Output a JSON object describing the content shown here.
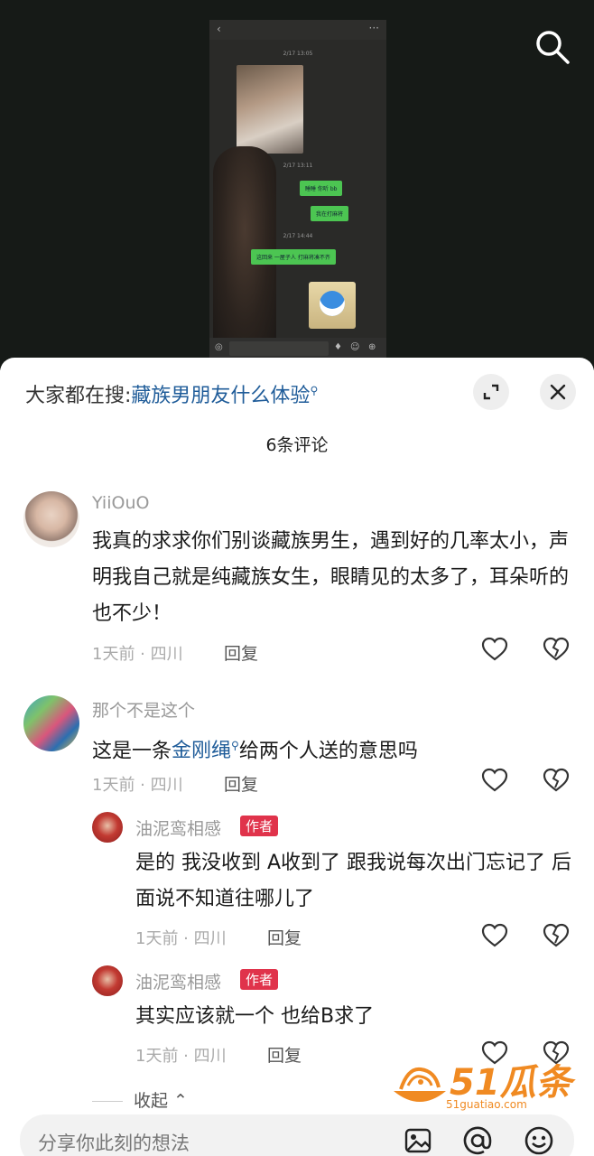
{
  "video": {
    "search_icon": "search-icon",
    "screenshot": {
      "time1": "2/17 13:05",
      "time2": "2/17 13:11",
      "time3": "2/17 14:44",
      "bubble1": "睡睡  你听 bb",
      "bubble2": "我在打麻将",
      "bubble3": "这回来 一屋子人 打麻将凑不齐"
    }
  },
  "sheet": {
    "suggest_prefix": "大家都在搜:",
    "suggest_query": "藏族男朋友什么体验",
    "comment_count": "6条评论",
    "comments": [
      {
        "user": "YiiOuO",
        "text": "我真的求求你们别谈藏族男生，遇到好的几率太小，声明我自己就是纯藏族女生，眼睛见的太多了，耳朵听的也不少！",
        "meta": "1天前 · 四川",
        "reply": "回复"
      },
      {
        "user": "那个不是这个",
        "text_before": "这是一条",
        "text_link": "金刚绳",
        "text_after": "给两个人送的意思吗",
        "meta": "1天前 · 四川",
        "reply": "回复"
      }
    ],
    "replies": [
      {
        "user": "油泥鸾相感",
        "badge": "作者",
        "text": "是的 我没收到 A收到了 跟我说每次出门忘记了 后面说不知道往哪儿了",
        "meta": "1天前 · 四川",
        "reply": "回复"
      },
      {
        "user": "油泥鸾相感",
        "badge": "作者",
        "text": "其实应该就一个 也给B求了",
        "meta": "1天前 · 四川",
        "reply": "回复"
      }
    ],
    "collapse_label": "收起",
    "input_placeholder": "分享你此刻的想法",
    "watermark": {
      "main": "51瓜条",
      "sub": "51guatiao.com"
    }
  },
  "colors": {
    "link": "#1f5c99",
    "badge": "#e0334b",
    "watermark": "#f08a22"
  }
}
